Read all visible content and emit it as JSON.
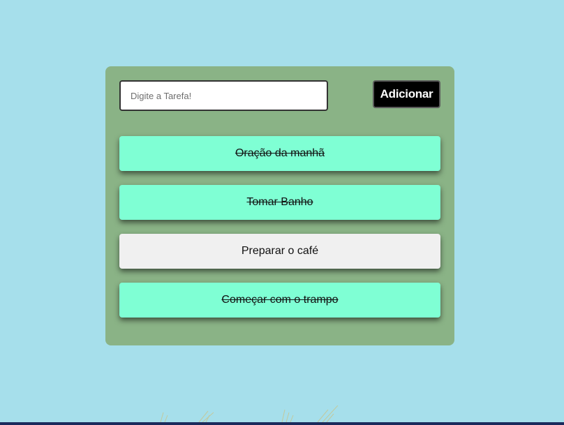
{
  "todo": {
    "input": {
      "placeholder": "Digite a Tarefa!",
      "value": ""
    },
    "add_button_label": "Adicionar",
    "tasks": [
      {
        "label": "Oração da manhã",
        "status": "done"
      },
      {
        "label": "Tomar Banho",
        "status": "done"
      },
      {
        "label": "Preparar o café",
        "status": "pending"
      },
      {
        "label": "Começar com o trampo",
        "status": "done"
      }
    ]
  },
  "colors": {
    "page_background": "#a6dfeb",
    "card_background": "#8ab386",
    "done_task": "#7fffd4",
    "pending_task": "#f0f0f0",
    "button_background": "#000000"
  }
}
